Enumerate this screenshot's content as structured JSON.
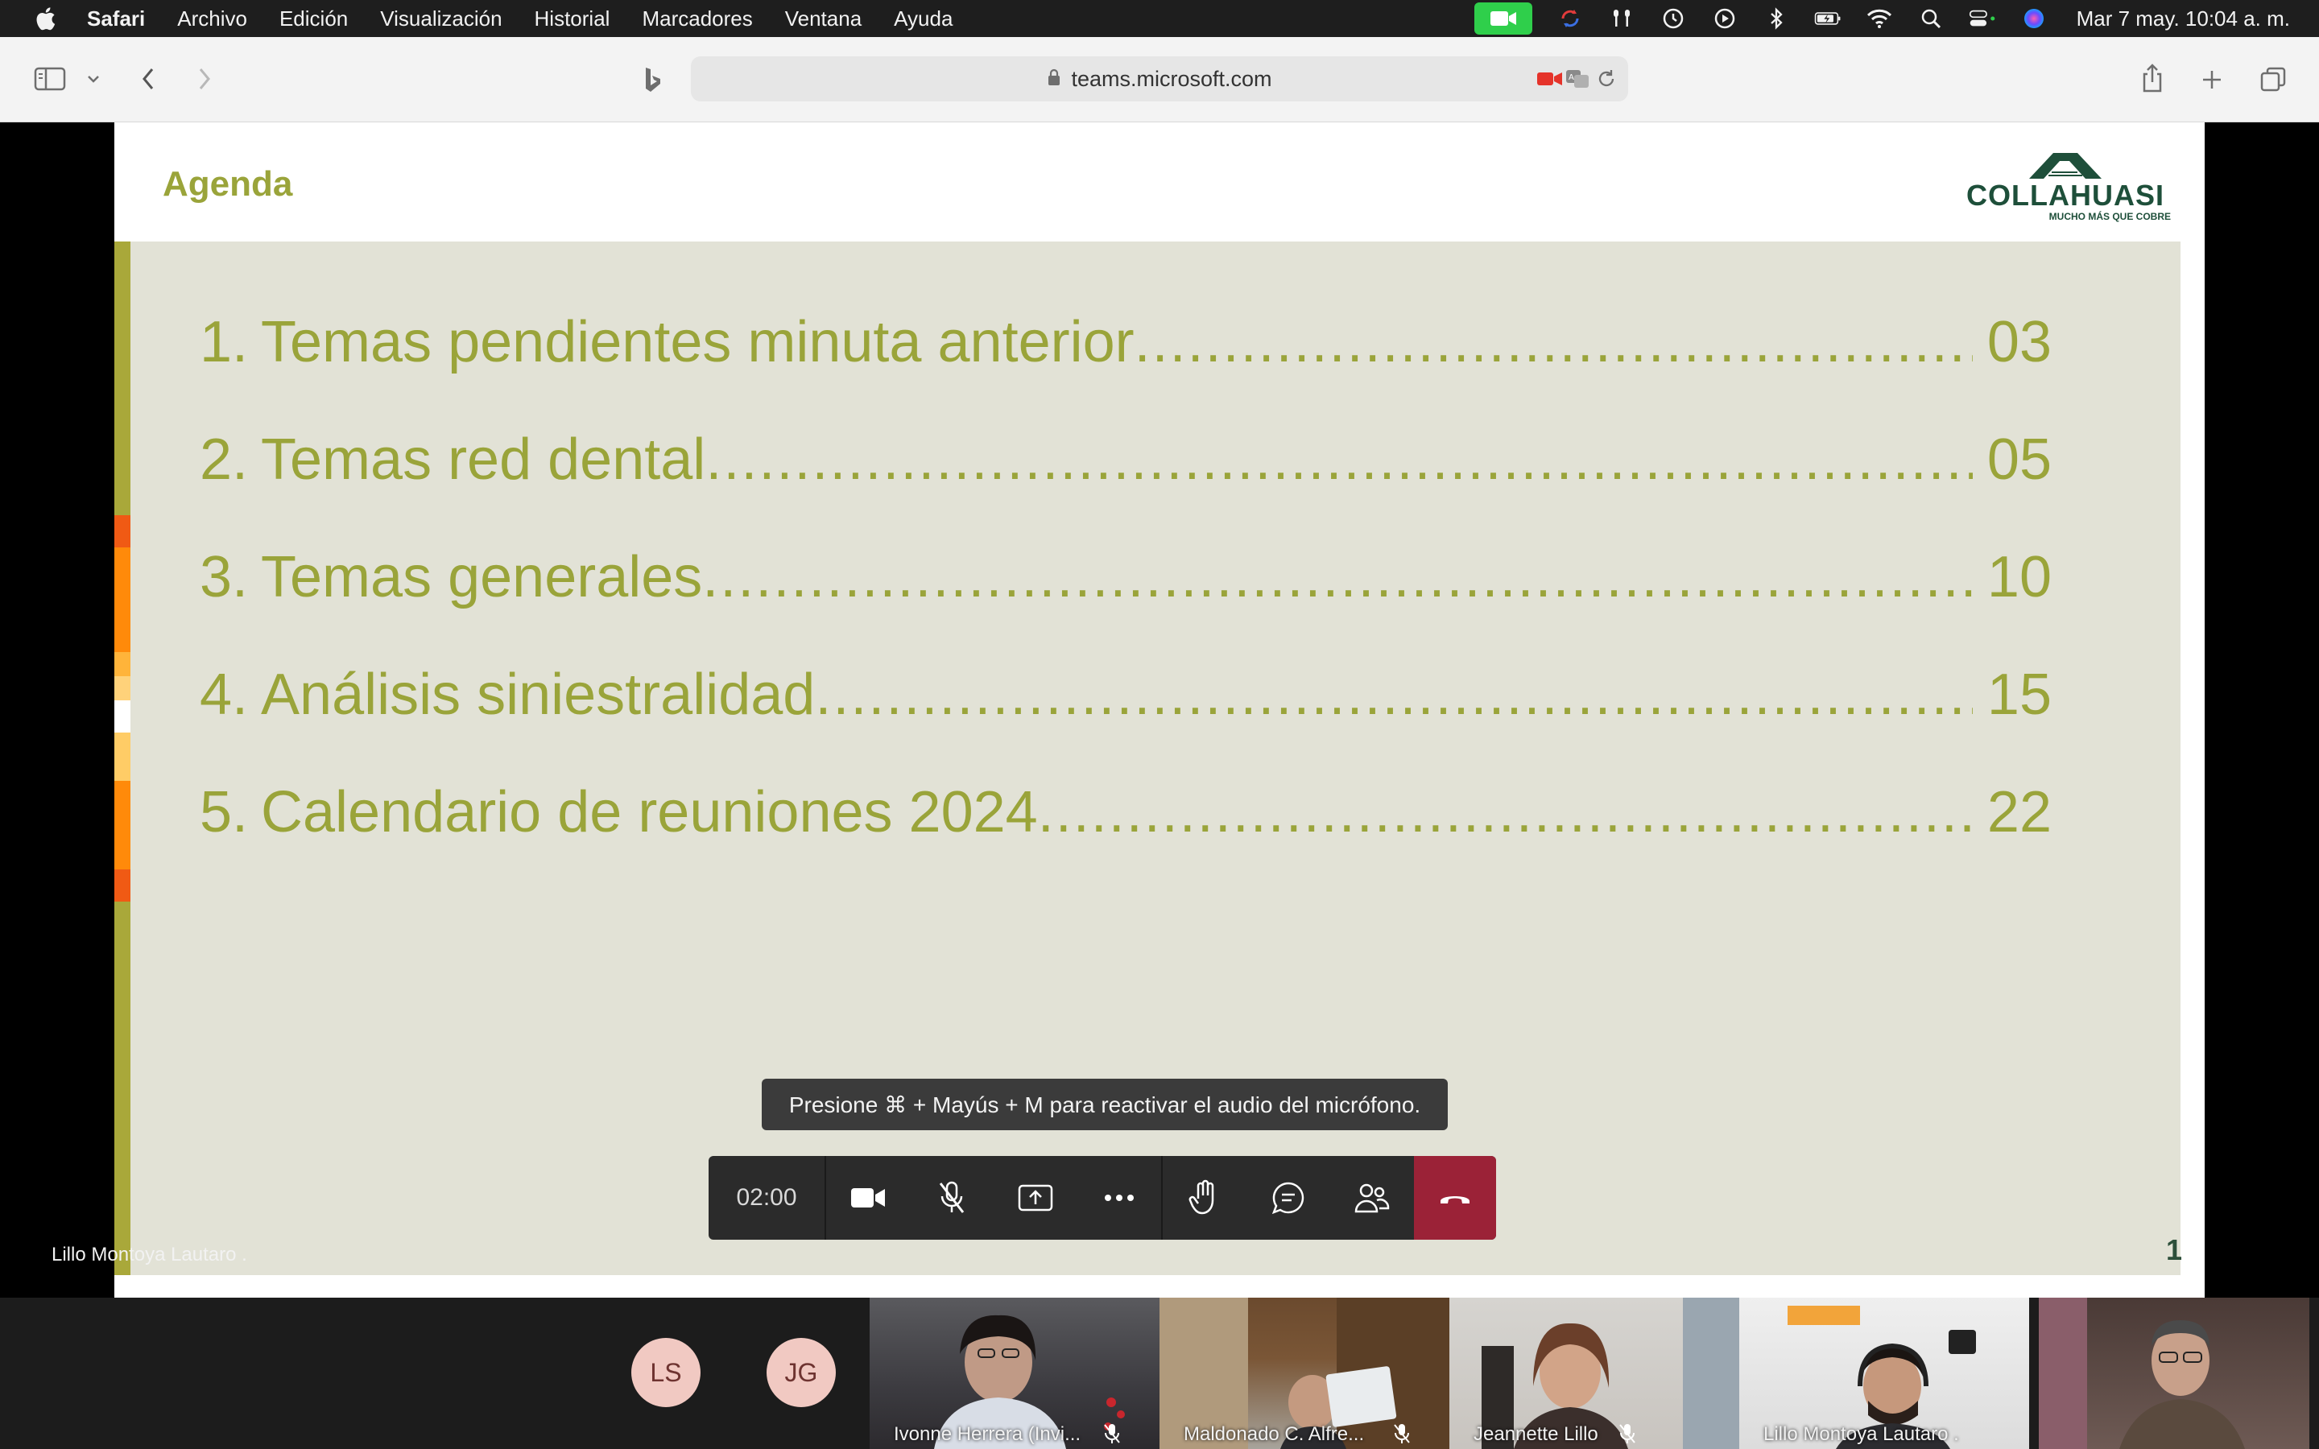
{
  "menubar": {
    "app": "Safari",
    "menus": [
      "Archivo",
      "Edición",
      "Visualización",
      "Historial",
      "Marcadores",
      "Ventana",
      "Ayuda"
    ],
    "datetime": "Mar 7 may.  10:04 a. m.",
    "status_icons": [
      "facetime-icon",
      "sync-icon",
      "airpods-icon",
      "time-machine-icon",
      "play-icon",
      "bluetooth-icon",
      "battery-icon",
      "wifi-icon",
      "spotlight-icon",
      "control-center-icon",
      "siri-icon"
    ]
  },
  "browser": {
    "url": "teams.microsoft.com"
  },
  "slide": {
    "title": "Agenda",
    "logo_text": "COLLAHUASI",
    "logo_tagline": "MUCHO MÁS QUE COBRE",
    "items": [
      {
        "num": "1.",
        "text": "Temas pendientes minuta anterior",
        "page": "03"
      },
      {
        "num": "2.",
        "text": "Temas red dental",
        "page": "05"
      },
      {
        "num": "3.",
        "text": "Temas generales",
        "page": "10"
      },
      {
        "num": "4.",
        "text": "Análisis siniestralidad",
        "page": "15"
      },
      {
        "num": "5.",
        "text": "Calendario de reuniones 2024 ",
        "page": "22"
      }
    ],
    "slide_number": "1"
  },
  "presenter_label": "Lillo Montoya Lautaro .",
  "toast": "Presione ⌘ + Mayús + M para reactivar el audio del micrófono.",
  "call": {
    "timer": "02:00"
  },
  "participants": {
    "avatars": [
      "LS",
      "JG"
    ],
    "tiles": [
      {
        "name": "Ivonne Herrera (Invi..."
      },
      {
        "name": "Maldonado C. Alfre..."
      },
      {
        "name": "Jeannette Lillo"
      },
      {
        "name": "Lillo Montoya Lautaro ."
      },
      {
        "name": ""
      }
    ]
  },
  "colors": {
    "accent_olive": "#9aa43a",
    "brand_green": "#1e4f3a",
    "hangup_red": "#9b2237",
    "facetime_green": "#2fcf4b"
  }
}
